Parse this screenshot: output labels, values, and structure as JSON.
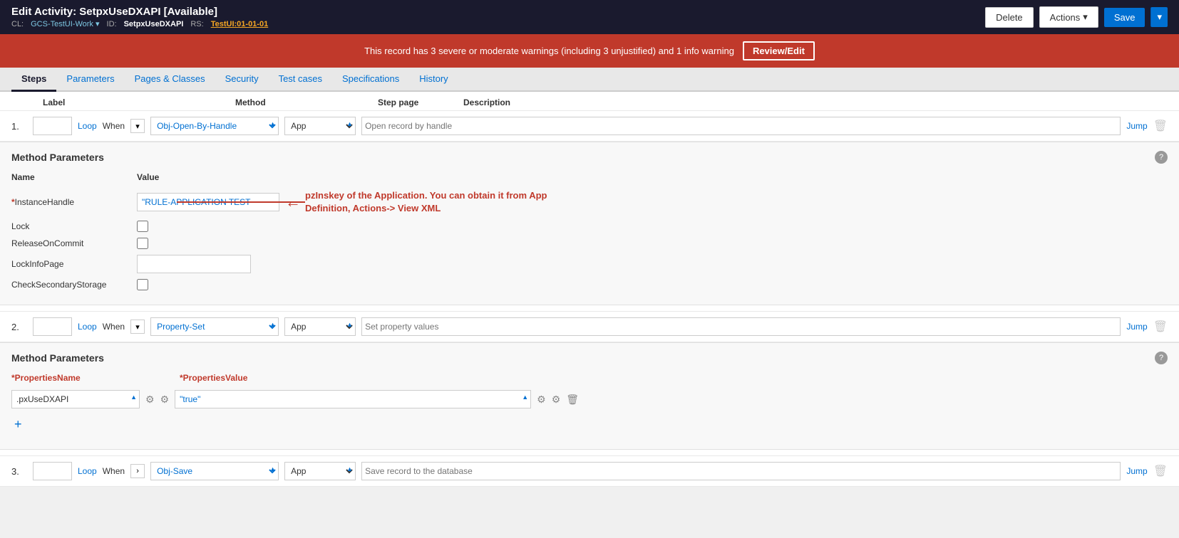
{
  "header": {
    "title": "Edit Activity: SetpxUseDXAPI [Available]",
    "cl_label": "CL:",
    "cl_value": "GCS-TestUI-Work",
    "id_label": "ID:",
    "id_value": "SetpxUseDXAPI",
    "rs_label": "RS:",
    "rs_value": "TestUI:01-01-01"
  },
  "buttons": {
    "delete": "Delete",
    "actions": "Actions",
    "actions_arrow": "▾",
    "save": "Save",
    "save_dropdown": "▾"
  },
  "warning": {
    "text": "This record has 3 severe or moderate warnings (including 3 unjustified) and 1 info warning",
    "review_btn": "Review/Edit"
  },
  "tabs": [
    {
      "label": "Steps",
      "active": true
    },
    {
      "label": "Parameters",
      "active": false
    },
    {
      "label": "Pages & Classes",
      "active": false
    },
    {
      "label": "Security",
      "active": false
    },
    {
      "label": "Test cases",
      "active": false
    },
    {
      "label": "Specifications",
      "active": false
    },
    {
      "label": "History",
      "active": false
    }
  ],
  "column_headers": {
    "label": "Label",
    "method": "Method",
    "step_page": "Step page",
    "description": "Description"
  },
  "step1": {
    "number": "1.",
    "loop": "Loop",
    "when": "When",
    "method": "Obj-Open-By-Handle",
    "step_page": "App",
    "description_placeholder": "Open record by handle",
    "jump": "Jump"
  },
  "method_params1": {
    "title": "Method Parameters",
    "name_col": "Name",
    "value_col": "Value",
    "params": [
      {
        "name": "InstanceHandle",
        "required": true,
        "value": "\"RULE-APPLICATION TEST",
        "type": "text"
      },
      {
        "name": "Lock",
        "required": false,
        "value": "",
        "type": "checkbox"
      },
      {
        "name": "ReleaseOnCommit",
        "required": false,
        "value": "",
        "type": "checkbox"
      },
      {
        "name": "LockInfoPage",
        "required": false,
        "value": "",
        "type": "text_empty"
      },
      {
        "name": "CheckSecondaryStorage",
        "required": false,
        "value": "",
        "type": "checkbox"
      }
    ]
  },
  "annotation": {
    "text": "pzInskey of the Application. You can obtain it from App\nDefinition, Actions-> View XML"
  },
  "step2": {
    "number": "2.",
    "loop": "Loop",
    "when": "When",
    "method": "Property-Set",
    "step_page": "App",
    "description_placeholder": "Set property values",
    "jump": "Jump"
  },
  "method_params2": {
    "title": "Method Parameters",
    "properties_name_label": "*PropertiesName",
    "properties_value_label": "*PropertiesValue",
    "properties_name_value": ".pxUseDXAPI",
    "properties_value_value": "\"true\""
  },
  "step3": {
    "number": "3.",
    "loop": "Loop",
    "when": "When",
    "method": "Obj-Save",
    "step_page": "App",
    "description_placeholder": "Save record to the database",
    "jump": "Jump"
  }
}
